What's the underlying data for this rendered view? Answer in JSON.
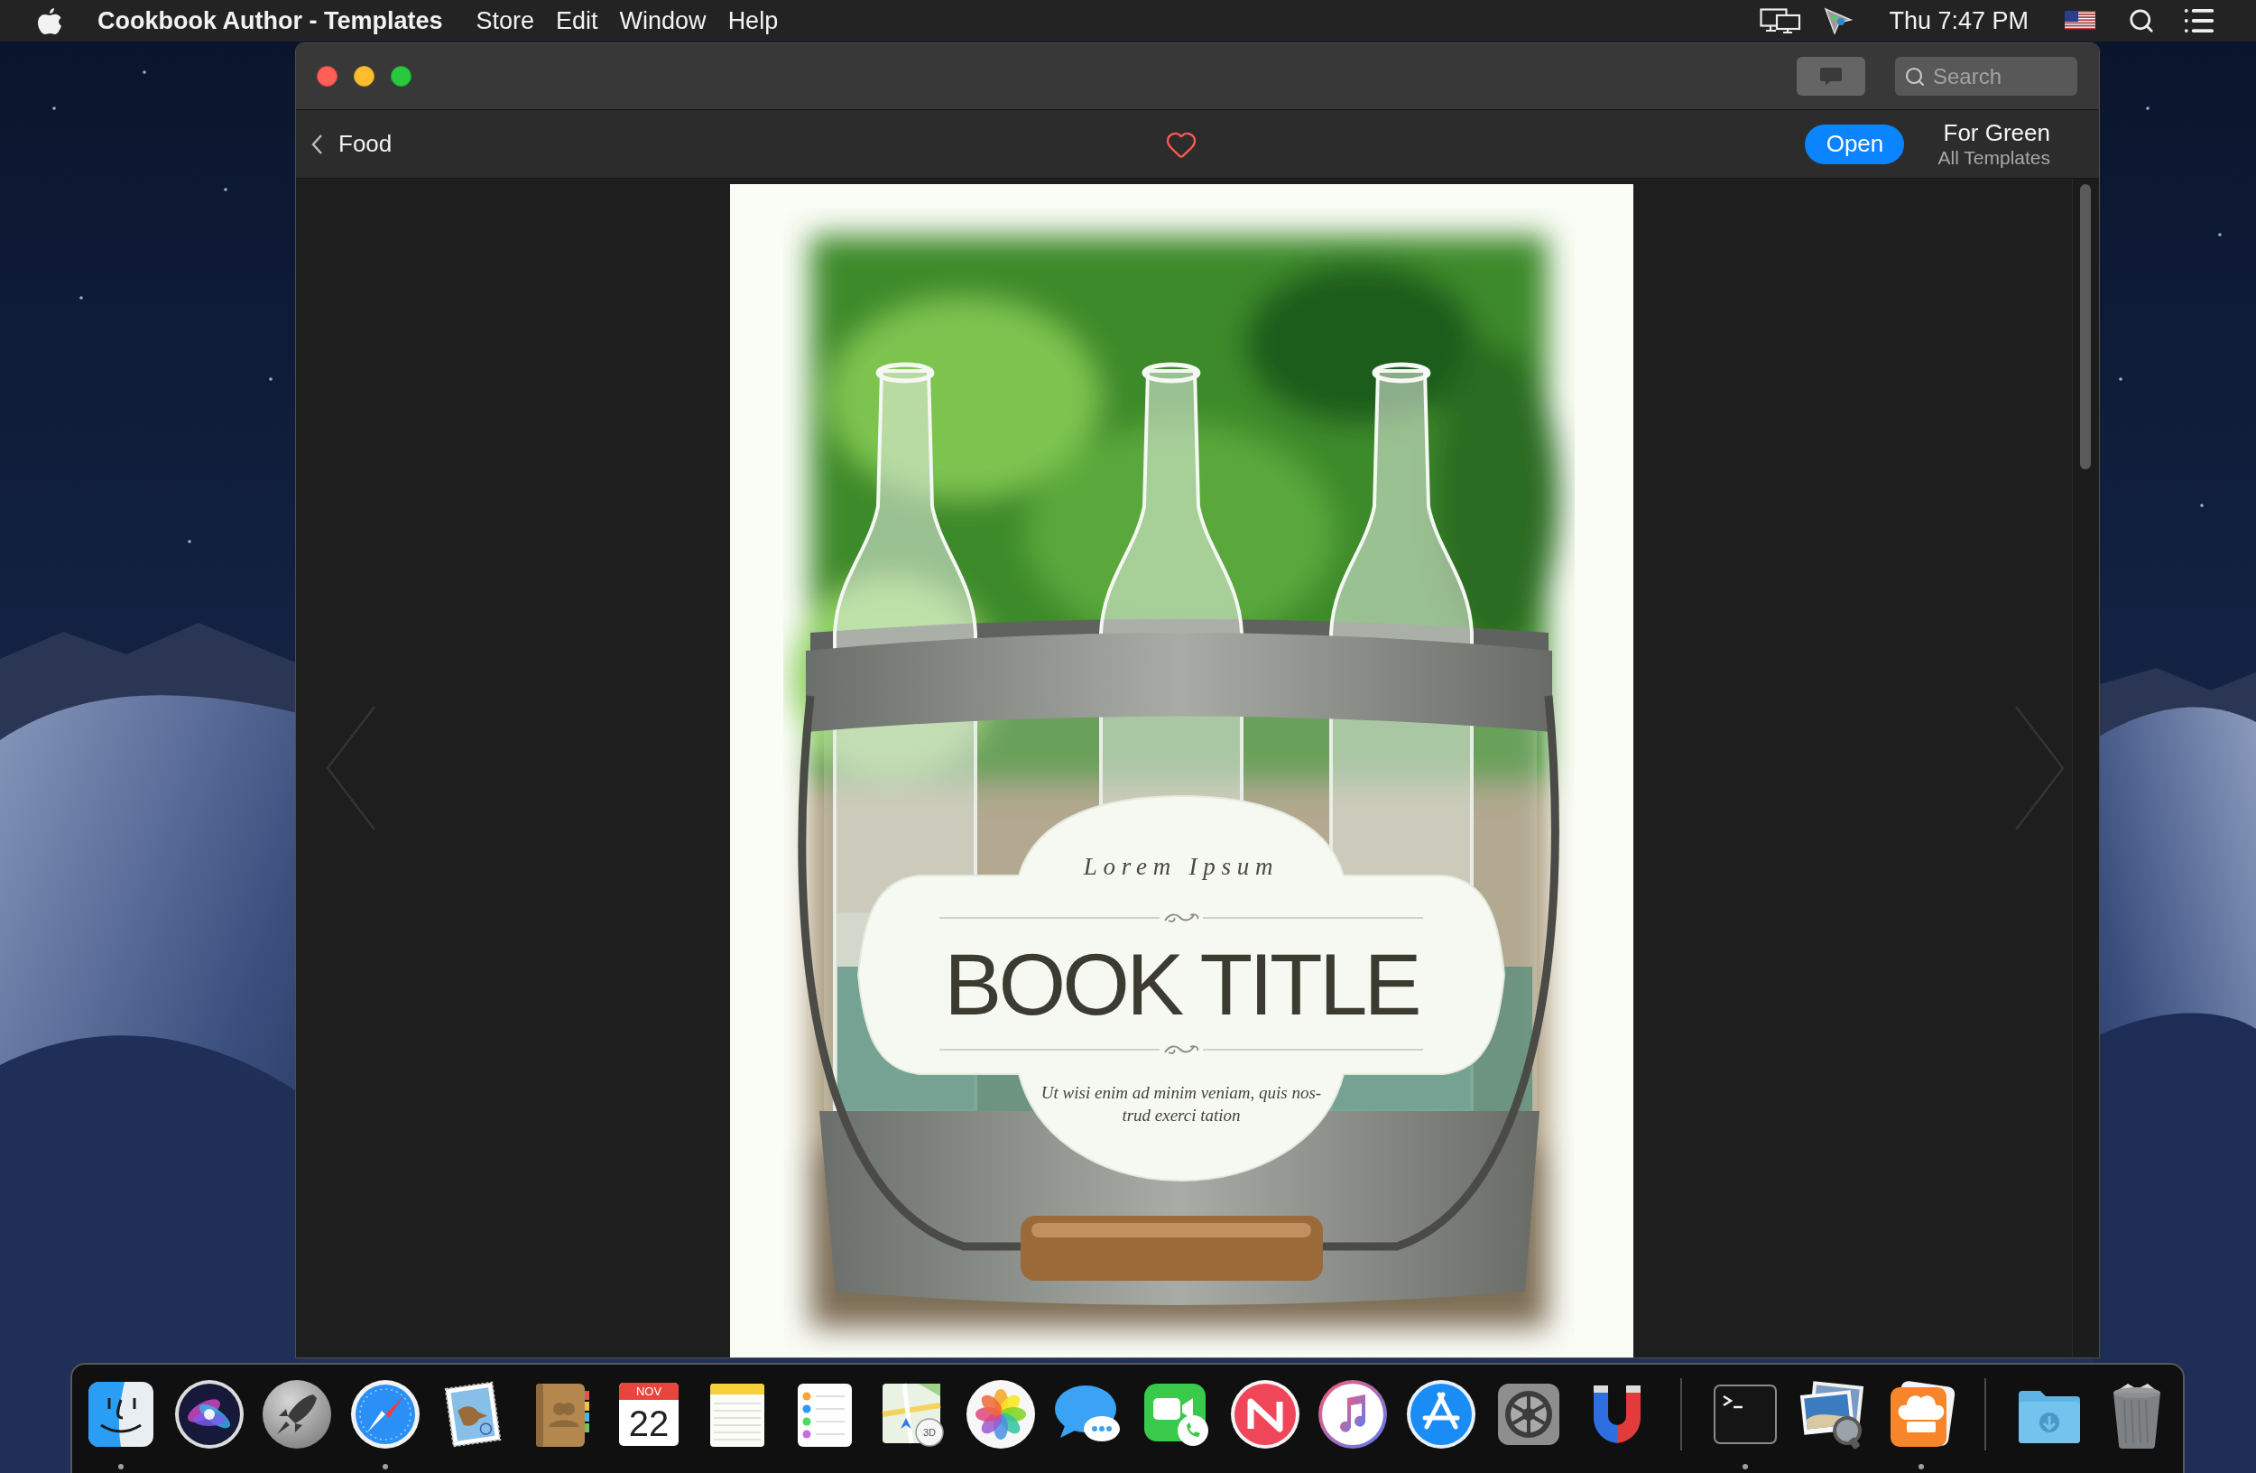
{
  "menu_bar": {
    "app_name": "Cookbook Author - Templates",
    "menus": [
      "Store",
      "Edit",
      "Window",
      "Help"
    ],
    "clock": "Thu 7:47 PM"
  },
  "window": {
    "search": {
      "placeholder": "Search"
    },
    "nav": {
      "back_label": "Food",
      "liked": false,
      "open_button": "Open",
      "template_name": "For Green",
      "template_group": "All Templates"
    },
    "cover": {
      "eyebrow": "Lorem Ipsum",
      "title": "BOOK TITLE",
      "subtitle": "Ut wisi enim ad minim veniam, quis nos-trud exerci tation"
    }
  },
  "dock": {
    "sections": [
      {
        "items": [
          {
            "kind": "finder",
            "running": true
          },
          {
            "kind": "siri",
            "running": false
          },
          {
            "kind": "launchpad",
            "running": false
          },
          {
            "kind": "safari",
            "running": true
          },
          {
            "kind": "mail",
            "running": false
          },
          {
            "kind": "contacts",
            "running": false
          },
          {
            "kind": "calendar",
            "running": false,
            "month": "NOV",
            "day": "22"
          },
          {
            "kind": "notes",
            "running": false
          },
          {
            "kind": "reminders",
            "running": false
          },
          {
            "kind": "maps",
            "running": false,
            "badge": "3D"
          },
          {
            "kind": "photos",
            "running": false
          },
          {
            "kind": "messages",
            "running": false
          },
          {
            "kind": "facetime",
            "running": false
          },
          {
            "kind": "news",
            "running": false
          },
          {
            "kind": "music",
            "running": false
          },
          {
            "kind": "appstore",
            "running": false
          },
          {
            "kind": "preferences",
            "running": false
          },
          {
            "kind": "magnet",
            "running": false
          }
        ]
      },
      {
        "items": [
          {
            "kind": "terminal",
            "running": true
          },
          {
            "kind": "preview",
            "running": false
          },
          {
            "kind": "cookbook",
            "running": true
          }
        ]
      },
      {
        "items": [
          {
            "kind": "downloads",
            "running": false
          },
          {
            "kind": "trash",
            "running": false
          }
        ]
      }
    ]
  }
}
